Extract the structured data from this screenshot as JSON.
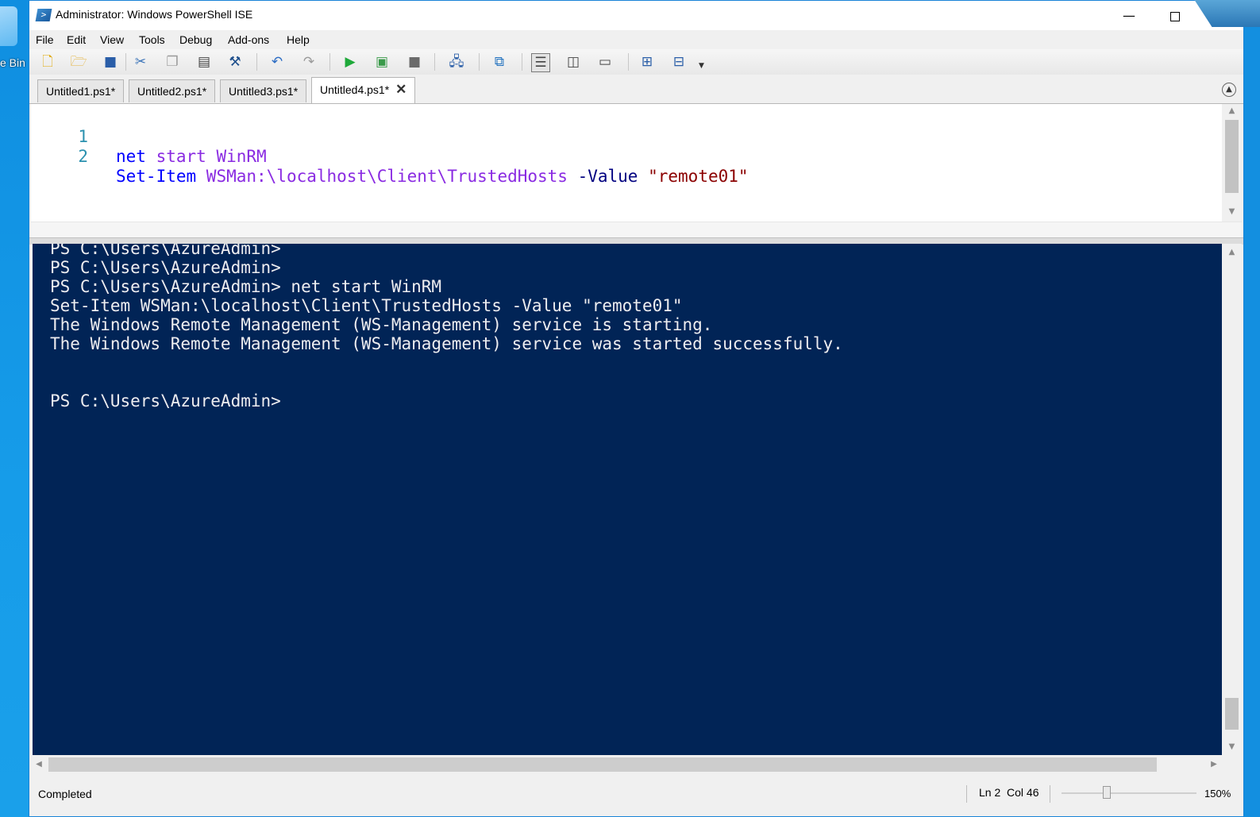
{
  "desktop": {
    "recycle_label": "e Bin"
  },
  "window": {
    "title": "Administrator: Windows PowerShell ISE",
    "minimize_label": "—",
    "close_label": "✕"
  },
  "menu": [
    "File",
    "Edit",
    "View",
    "Tools",
    "Debug",
    "Add-ons",
    "Help"
  ],
  "toolbar": {
    "icons": [
      "new-file-icon",
      "open-folder-icon",
      "save-icon",
      "cut-icon",
      "copy-icon",
      "paste-icon",
      "clear-pane-icon",
      "undo-icon",
      "redo-icon",
      "run-icon",
      "run-selection-icon",
      "stop-icon",
      "remote-powershell-icon",
      "start-powershell-icon",
      "script-pane-top-icon",
      "script-pane-right-icon",
      "script-pane-maximized-icon",
      "show-command-icon",
      "show-addon-icon"
    ]
  },
  "tabs": [
    {
      "label": "Untitled1.ps1*",
      "active": false
    },
    {
      "label": "Untitled2.ps1*",
      "active": false
    },
    {
      "label": "Untitled3.ps1*",
      "active": false
    },
    {
      "label": "Untitled4.ps1*",
      "active": true
    }
  ],
  "editor": {
    "lines": [
      {
        "number": "1",
        "cmd": "net",
        "rest1": " start WinRM",
        "param": "",
        "str": ""
      },
      {
        "number": "2",
        "cmd": "Set-Item",
        "rest1": " WSMan:\\localhost\\Client\\TrustedHosts",
        "param": " -Value ",
        "str": "\"remote01\""
      }
    ]
  },
  "console": {
    "lines": [
      "PS C:\\Users\\AzureAdmin>",
      "PS C:\\Users\\AzureAdmin>",
      "PS C:\\Users\\AzureAdmin> net start WinRM",
      "Set-Item WSMan:\\localhost\\Client\\TrustedHosts -Value \"remote01\"",
      "The Windows Remote Management (WS-Management) service is starting.",
      "The Windows Remote Management (WS-Management) service was started successfully.",
      "",
      "",
      "PS C:\\Users\\AzureAdmin>"
    ],
    "background": "#012456",
    "foreground": "#eeedf0"
  },
  "status": {
    "text": "Completed",
    "ln": "Ln 2",
    "col": "Col 46",
    "zoom": "150%"
  }
}
